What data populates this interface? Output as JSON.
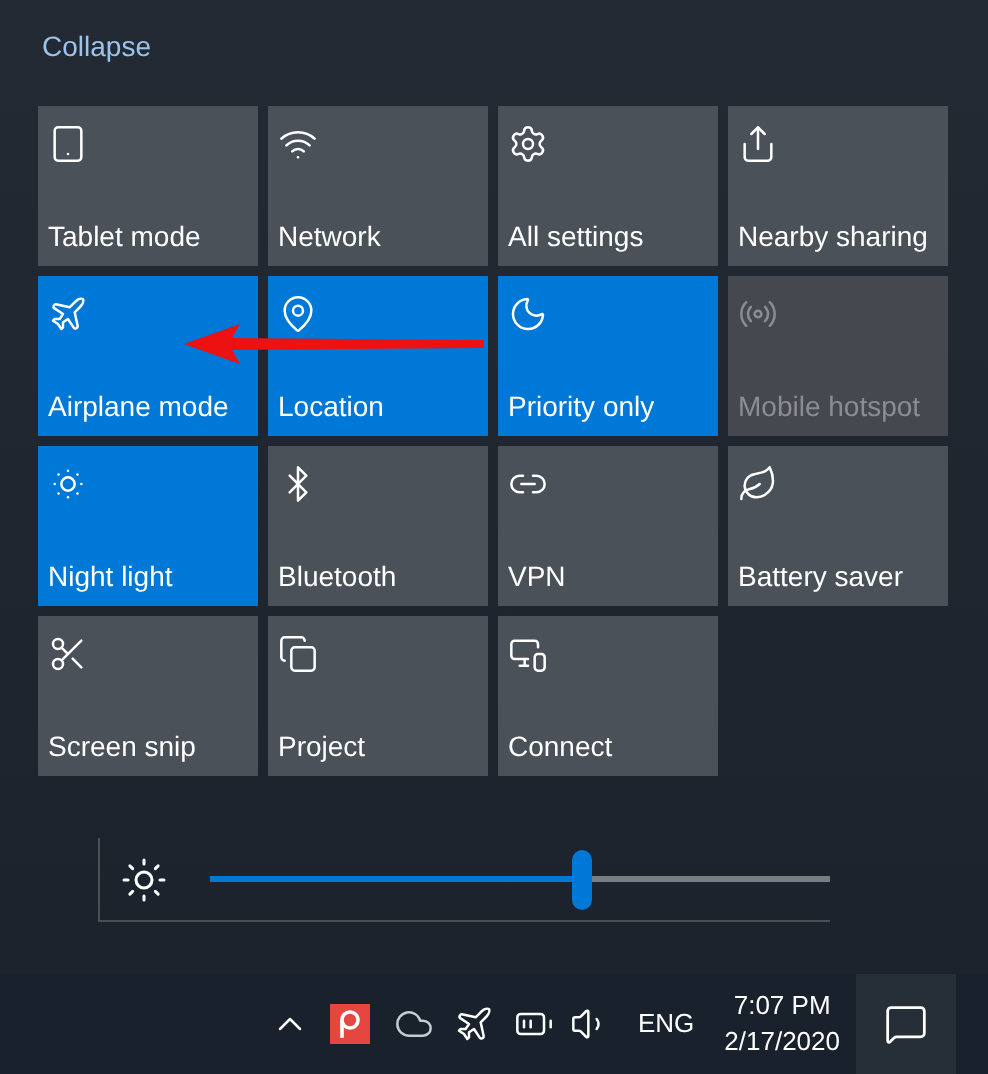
{
  "collapse_link": "Collapse",
  "tiles": [
    {
      "label": "Tablet mode",
      "on": false,
      "disabled": false
    },
    {
      "label": "Network",
      "on": false,
      "disabled": false
    },
    {
      "label": "All settings",
      "on": false,
      "disabled": false
    },
    {
      "label": "Nearby sharing",
      "on": false,
      "disabled": false
    },
    {
      "label": "Airplane mode",
      "on": true,
      "disabled": false
    },
    {
      "label": "Location",
      "on": true,
      "disabled": false
    },
    {
      "label": "Priority only",
      "on": true,
      "disabled": false
    },
    {
      "label": "Mobile hotspot",
      "on": false,
      "disabled": true
    },
    {
      "label": "Night light",
      "on": true,
      "disabled": false
    },
    {
      "label": "Bluetooth",
      "on": false,
      "disabled": false
    },
    {
      "label": "VPN",
      "on": false,
      "disabled": false
    },
    {
      "label": "Battery saver",
      "on": false,
      "disabled": false
    },
    {
      "label": "Screen snip",
      "on": false,
      "disabled": false
    },
    {
      "label": "Project",
      "on": false,
      "disabled": false
    },
    {
      "label": "Connect",
      "on": false,
      "disabled": false
    }
  ],
  "brightness": {
    "level": 0.6
  },
  "taskbar": {
    "language": "ENG",
    "time": "7:07 PM",
    "date": "2/17/2020"
  }
}
